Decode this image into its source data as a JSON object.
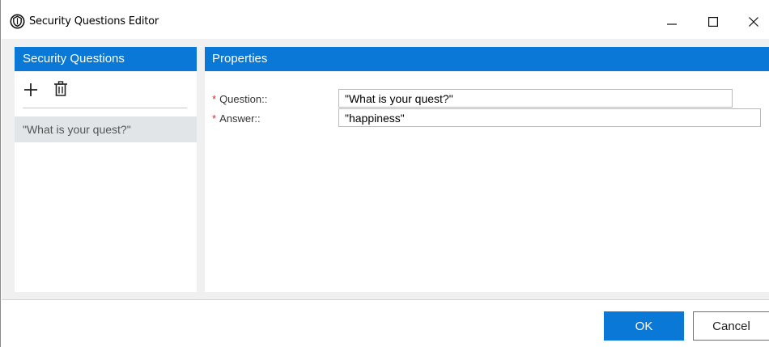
{
  "window": {
    "title": "Security Questions Editor",
    "icon": "shield-logo-icon",
    "controls": [
      "minimize-icon",
      "maximize-icon",
      "close-icon"
    ]
  },
  "left_panel": {
    "header": "Security Questions",
    "toolbar": {
      "add_icon": "plus-icon",
      "delete_icon": "trash-icon"
    },
    "items": [
      {
        "label": "\"What is your quest?\"",
        "selected": true
      }
    ]
  },
  "properties": {
    "header": "Properties",
    "required_marker": "*",
    "question_label": "Question::",
    "question_value": "\"What is your quest?\"",
    "answer_label": "Answer::",
    "answer_value": "\"happiness\""
  },
  "footer": {
    "ok_label": "OK",
    "cancel_label": "Cancel"
  },
  "colors": {
    "accent": "#0a78d7",
    "required": "#d32f2f",
    "selected_item": "#e2e5e8",
    "background": "#f0f0f0"
  }
}
